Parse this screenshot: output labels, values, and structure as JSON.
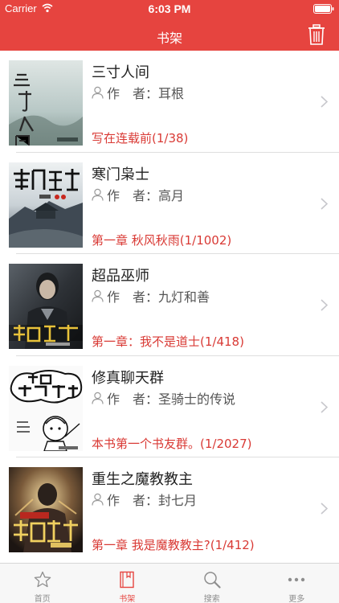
{
  "status_bar": {
    "carrier": "Carrier",
    "time": "6:03 PM"
  },
  "nav": {
    "title": "书架",
    "accent_color": "#e6443f"
  },
  "books": [
    {
      "title": "三寸人间",
      "author_label": "作　者：",
      "author": "耳根",
      "chapter": "写在连载前(1/38)",
      "cover": "cover-sancun"
    },
    {
      "title": "寒门枭士",
      "author_label": "作　者：",
      "author": "高月",
      "chapter": "第一章 秋风秋雨(1/1002)",
      "cover": "cover-hanmen"
    },
    {
      "title": "超品巫师",
      "author_label": "作　者：",
      "author": "九灯和善",
      "chapter": "第一章：我不是道士(1/418)",
      "cover": "cover-chaopin"
    },
    {
      "title": "修真聊天群",
      "author_label": "作　者：",
      "author": "圣骑士的传说",
      "chapter": "本书第一个书友群。(1/2027)",
      "cover": "cover-xiuzhen"
    },
    {
      "title": "重生之魔教教主",
      "author_label": "作　者：",
      "author": "封七月",
      "chapter": "第一章 我是魔教教主?(1/412)",
      "cover": "cover-chongsheng"
    }
  ],
  "tabs": [
    {
      "label": "首页",
      "icon": "star-icon"
    },
    {
      "label": "书架",
      "icon": "book-icon",
      "active": true
    },
    {
      "label": "搜索",
      "icon": "search-icon"
    },
    {
      "label": "更多",
      "icon": "more-icon"
    }
  ]
}
